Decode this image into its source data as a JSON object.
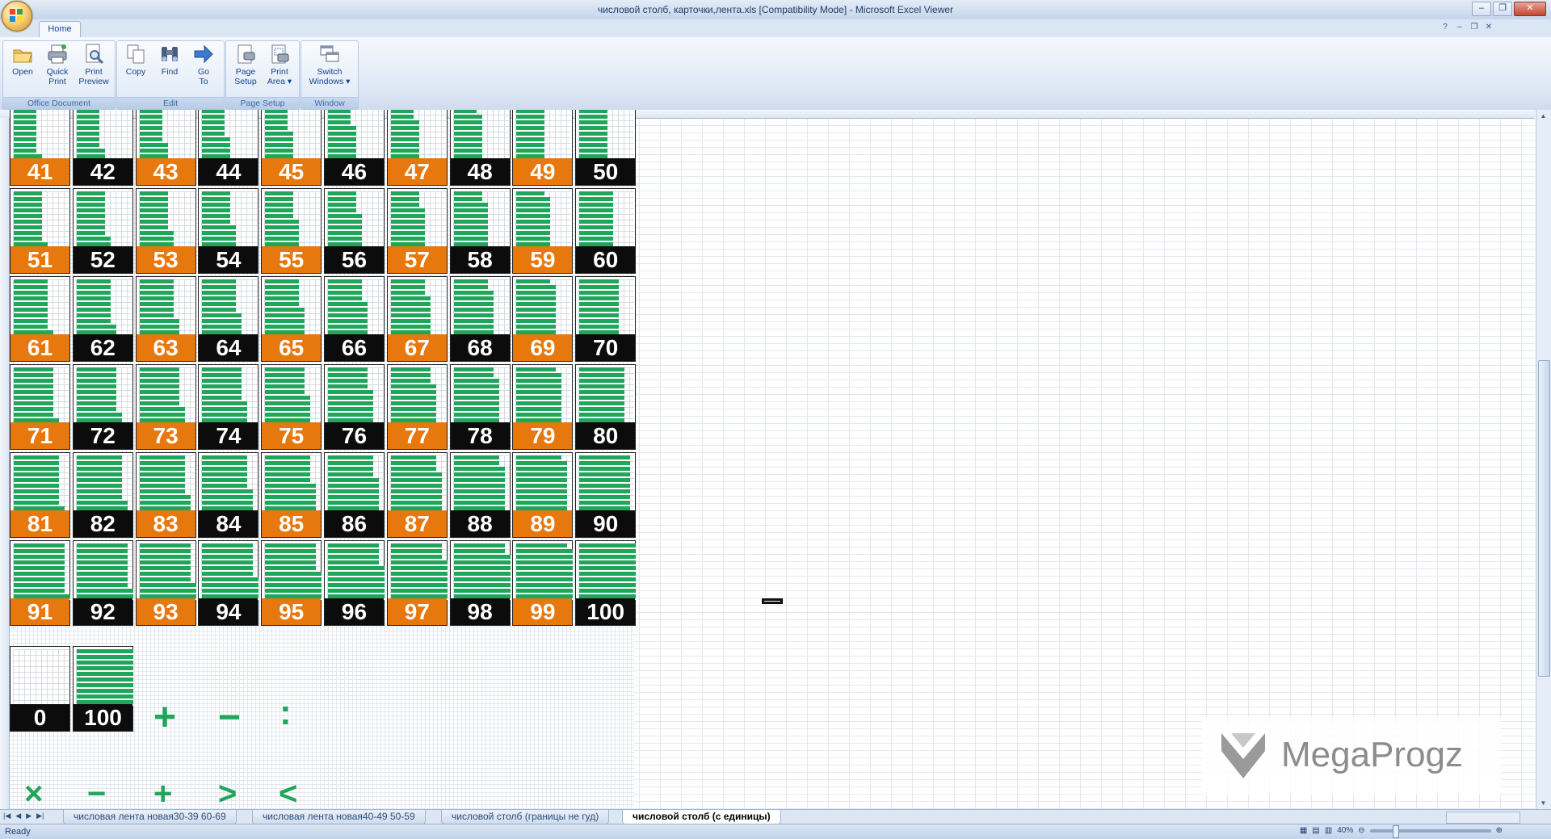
{
  "window": {
    "title": "числовой столб, карточки,лента.xls  [Compatibility Mode] - Microsoft Excel Viewer",
    "min_icon": "minimize-icon",
    "max_icon": "restore-icon",
    "close_icon": "close-icon"
  },
  "ribbon": {
    "tab_home": "Home",
    "groups": [
      {
        "label": "Office Document",
        "buttons": [
          "Open",
          "Quick Print",
          "Print Preview"
        ]
      },
      {
        "label": "Edit",
        "buttons": [
          "Copy",
          "Find",
          "Go To"
        ]
      },
      {
        "label": "Page Setup",
        "buttons": [
          "Page Setup",
          "Print Area"
        ]
      },
      {
        "label": "Window",
        "buttons": [
          "Switch Windows"
        ]
      }
    ],
    "open": "Open",
    "quick_print_1": "Quick",
    "quick_print_2": "Print",
    "print_preview_1": "Print",
    "print_preview_2": "Preview",
    "copy": "Copy",
    "find": "Find",
    "goto_1": "Go",
    "goto_2": "To",
    "page_setup_1": "Page",
    "page_setup_2": "Setup",
    "print_area_1": "Print",
    "print_area_2": "Area ▾",
    "switch_1": "Switch",
    "switch_2": "Windows ▾",
    "group_office": "Office Document",
    "group_edit": "Edit",
    "group_pagesetup": "Page Setup",
    "group_window": "Window"
  },
  "cards": {
    "start": 41,
    "end": 100,
    "colors": {
      "orange": "#e7780d",
      "black": "#0c0c0c",
      "green": "#1fa65a"
    }
  },
  "extra_cards": [
    {
      "label": "0",
      "fill": 0
    },
    {
      "label": "100",
      "fill": 100
    }
  ],
  "symbols": [
    "+",
    "−",
    ":",
    "×",
    "−",
    "+",
    ">",
    "<"
  ],
  "watermark": "MegaProgz",
  "sheet_tabs": [
    {
      "label": "числовая лента новая30-39 60-69",
      "active": false
    },
    {
      "label": "числовая лента новая40-49 50-59",
      "active": false
    },
    {
      "label": "числовой столб (границы не гуд)",
      "active": false
    },
    {
      "label": "числовой столб (с единицы)",
      "active": true
    }
  ],
  "status": {
    "ready": "Ready",
    "zoom": "40%"
  }
}
